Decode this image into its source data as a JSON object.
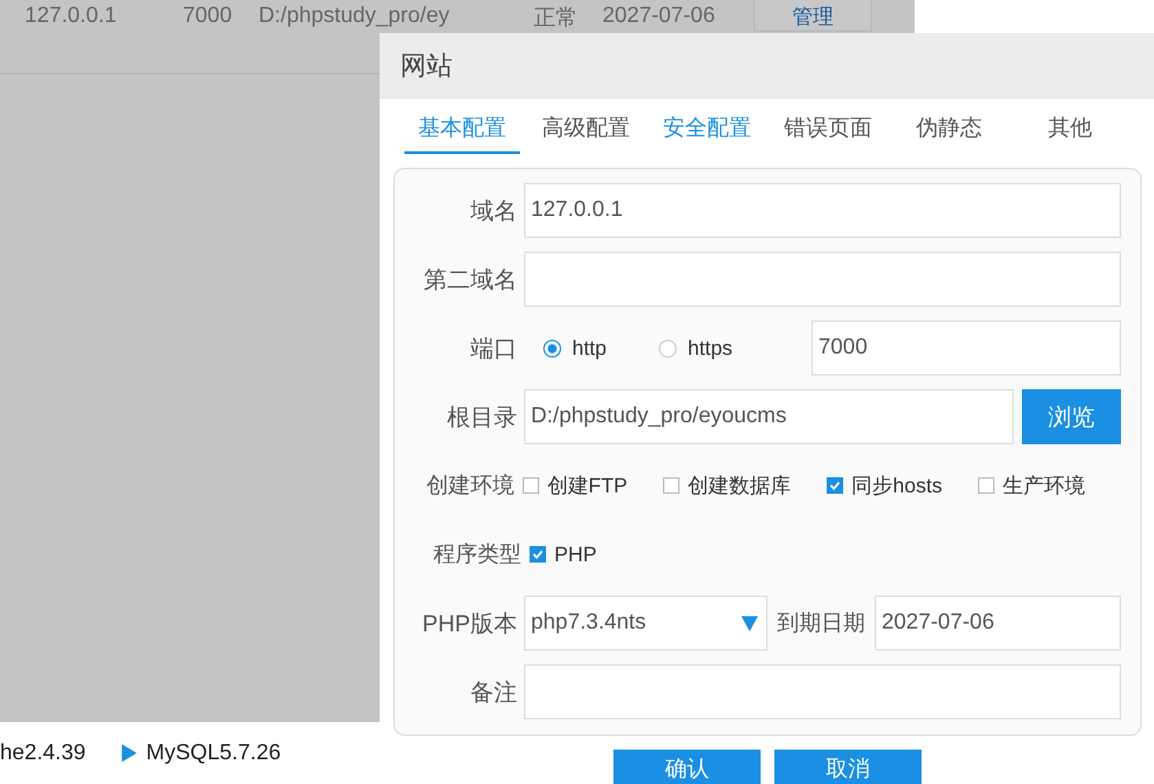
{
  "background_table": {
    "cells": [
      "127.0.0.1",
      "7000",
      "D:/phpstudy_pro/ey",
      "正常",
      "2027-07-06"
    ],
    "button": "管理"
  },
  "status_bar": [
    {
      "text": "he2.4.39",
      "running": false
    },
    {
      "text": "MySQL5.7.26",
      "running": true
    }
  ],
  "dialog": {
    "title": "网站",
    "tabs": [
      {
        "label": "基本配置",
        "selected": true,
        "hovered": false
      },
      {
        "label": "高级配置",
        "selected": false,
        "hovered": false
      },
      {
        "label": "安全配置",
        "selected": false,
        "hovered": true
      },
      {
        "label": "错误页面",
        "selected": false,
        "hovered": false
      },
      {
        "label": "伪静态",
        "selected": false,
        "hovered": false
      },
      {
        "label": "其他",
        "selected": false,
        "hovered": false
      }
    ],
    "rows": [
      {
        "kind": "text",
        "label": "域名",
        "value": "127.0.0.1"
      },
      {
        "kind": "text",
        "label": "第二域名"
      },
      {
        "kind": "port",
        "label": "端口",
        "options": [
          {
            "label": "http",
            "selected": true
          },
          {
            "label": "https",
            "selected": false
          }
        ],
        "value": "7000"
      },
      {
        "kind": "path",
        "label": "根目录",
        "value": "D:/phpstudy_pro/eyoucms",
        "button": "浏览"
      },
      {
        "kind": "checks",
        "label": "创建环境",
        "options": [
          {
            "label": "创建FTP",
            "checked": false
          },
          {
            "label": "创建数据库",
            "checked": false
          },
          {
            "label": "同步hosts",
            "checked": true
          },
          {
            "label": "生产环境",
            "checked": false
          }
        ]
      },
      {
        "kind": "checks",
        "label": "程序类型",
        "options": [
          {
            "label": "PHP",
            "checked": true
          }
        ]
      },
      {
        "kind": "select_date",
        "label": "PHP版本",
        "value": "php7.3.4nts",
        "label2": "到期日期",
        "value2": "2027-07-06"
      },
      {
        "kind": "text",
        "label": "备注"
      }
    ],
    "buttons": [
      "确认",
      "取消"
    ]
  }
}
